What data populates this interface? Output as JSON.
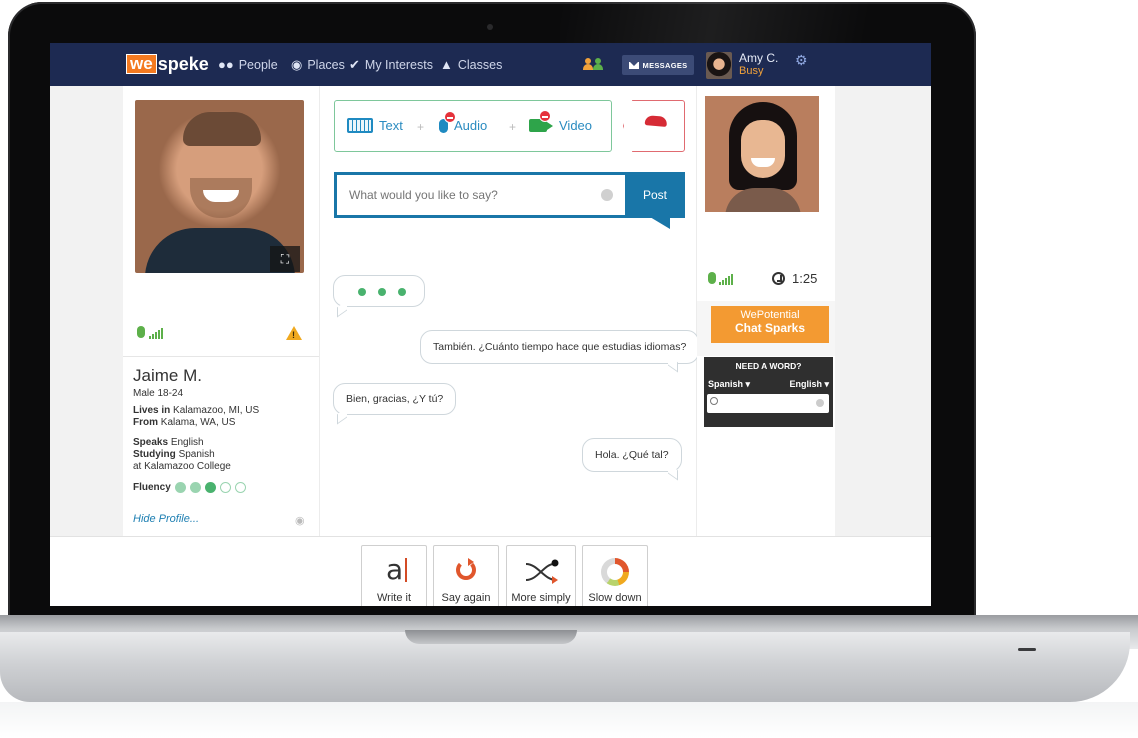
{
  "nav": {
    "logo_we": "we",
    "logo_rest": "speke",
    "people": "People",
    "places": "Places",
    "interests": "My Interests",
    "classes": "Classes",
    "messages": "MESSAGES",
    "user_name": "Amy C.",
    "user_status": "Busy",
    "colors": {
      "bar": "#1d2a52",
      "accent": "#f47a20",
      "status": "#f2a23a"
    }
  },
  "partner": {
    "name": "Jaime M.",
    "demographic": "Male 18-24",
    "lives_label": "Lives in",
    "lives": "Kalamazoo, MI, US",
    "from_label": "From",
    "from": "Kalama, WA, US",
    "speaks_label": "Speaks",
    "speaks": "English",
    "studying_label": "Studying",
    "studying": "Spanish",
    "school": "at Kalamazoo College",
    "fluency_label": "Fluency",
    "fluency_level": 3,
    "fluency_max": 5,
    "hide_profile": "Hide Profile..."
  },
  "modes": {
    "text": "Text",
    "audio": "Audio",
    "video": "Video"
  },
  "compose": {
    "placeholder": "What would you like to say?",
    "post": "Post"
  },
  "messages": [
    {
      "side": "right",
      "text": "También.  ¿Cuánto tiempo hace que estudias idiomas?"
    },
    {
      "side": "left",
      "text": "Bien, gracias, ¿Y tú?"
    },
    {
      "side": "right",
      "text": "Hola. ¿Qué tal?"
    }
  ],
  "self": {
    "timer": "1:25",
    "spark_line1": "WePotential",
    "spark_line2": "Chat Sparks",
    "dict_title": "NEED A WORD?",
    "dict_from": "Spanish ▾",
    "dict_to": "English ▾"
  },
  "tools": [
    {
      "label": "Write it",
      "icon": "text-cursor-icon",
      "glyph": "a"
    },
    {
      "label": "Say again",
      "icon": "repeat-icon"
    },
    {
      "label": "More simply",
      "icon": "shuffle-icon"
    },
    {
      "label": "Slow down",
      "icon": "speed-dial-icon"
    }
  ]
}
